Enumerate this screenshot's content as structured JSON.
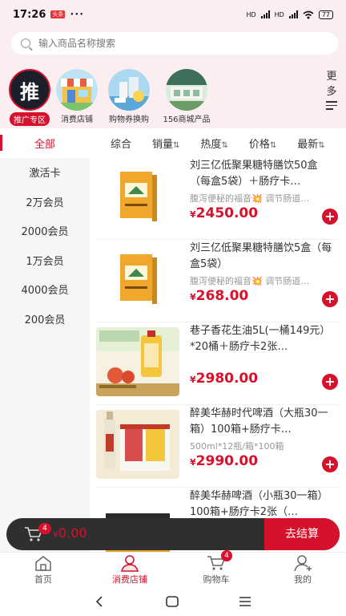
{
  "status_bar": {
    "time": "17:26",
    "badge": "头条",
    "dots": "···",
    "network1": "HD",
    "network2": "HD",
    "battery": "77"
  },
  "search": {
    "placeholder": "输入商品名称搜索"
  },
  "categories": [
    {
      "label": "推广专区",
      "icon_text": "推",
      "active": true
    },
    {
      "label": "消费店铺",
      "icon": "shop-icon"
    },
    {
      "label": "购物券换购",
      "icon": "coupon-icon"
    },
    {
      "label": "156商城产品",
      "icon": "mall-icon"
    }
  ],
  "more": {
    "line1": "更",
    "line2": "多"
  },
  "left_nav": [
    "全部",
    "激活卡",
    "2万会员",
    "2000会员",
    "1万会员",
    "4000会员",
    "200会员"
  ],
  "sort_bar": {
    "items": [
      "综合",
      "销量",
      "热度",
      "价格",
      "最新"
    ],
    "arrow": "⇅"
  },
  "products": [
    {
      "name": "刘三亿低聚果糖特膳饮50盒（每盒5袋）＋肠疗卡…",
      "sub": "腹泻便秘的福音💥 调节肠道…",
      "price": "2450.00"
    },
    {
      "name": "刘三亿低聚果糖特膳饮5盒（每盒5袋）",
      "sub": "腹泻便秘的福音💥 调节肠道…",
      "price": "268.00"
    },
    {
      "name": "巷子香花生油5L(一桶149元）*20桶＋肠疗卡2张…",
      "sub": "",
      "price": "2980.00"
    },
    {
      "name": "醉美华赫时代啤酒（大瓶30一箱）100箱+肠疗卡…",
      "sub": "500ml*12瓶/箱*100箱",
      "price": "2990.00"
    },
    {
      "name": "醉美华赫啤酒（小瓶30一箱）100箱+肠疗卡2张（…",
      "sub": "",
      "price": ""
    }
  ],
  "currency": "¥",
  "add_symbol": "+",
  "cart": {
    "badge": "4",
    "total": "0.00",
    "checkout_label": "去结算"
  },
  "tab_bar": [
    {
      "label": "首页"
    },
    {
      "label": "消费店铺",
      "active": true
    },
    {
      "label": "购物车",
      "badge": "4"
    },
    {
      "label": "我的"
    }
  ]
}
